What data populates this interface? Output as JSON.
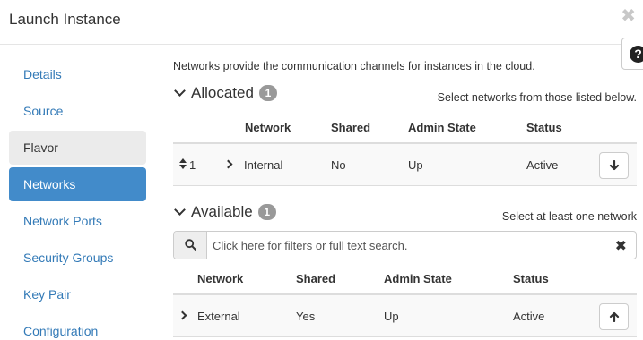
{
  "modal": {
    "title": "Launch Instance",
    "close_glyph": "✖"
  },
  "help": {
    "glyph": "?"
  },
  "sidebar": {
    "items": [
      {
        "label": "Details"
      },
      {
        "label": "Source"
      },
      {
        "label": "Flavor"
      },
      {
        "label": "Networks"
      },
      {
        "label": "Network Ports"
      },
      {
        "label": "Security Groups"
      },
      {
        "label": "Key Pair"
      },
      {
        "label": "Configuration"
      }
    ],
    "active": "Networks"
  },
  "main": {
    "intro": "Networks provide the communication channels for instances in the cloud.",
    "allocated": {
      "title": "Allocated",
      "count": "1",
      "helper": "Select networks from those listed below.",
      "columns": [
        "Network",
        "Shared",
        "Admin State",
        "Status"
      ],
      "rows": [
        {
          "order": "1",
          "network": "Internal",
          "shared": "No",
          "admin_state": "Up",
          "status": "Active",
          "action_icon": "arrow-down-icon"
        }
      ]
    },
    "available": {
      "title": "Available",
      "count": "1",
      "helper": "Select at least one network",
      "search": {
        "placeholder": "Click here for filters or full text search.",
        "value": ""
      },
      "columns": [
        "Network",
        "Shared",
        "Admin State",
        "Status"
      ],
      "rows": [
        {
          "network": "External",
          "shared": "Yes",
          "admin_state": "Up",
          "status": "Active",
          "action_icon": "arrow-up-icon"
        }
      ]
    }
  },
  "colors": {
    "accent": "#428bca",
    "link": "#337ab7",
    "badge": "#999999",
    "row_bg": "#f9f9f9"
  }
}
